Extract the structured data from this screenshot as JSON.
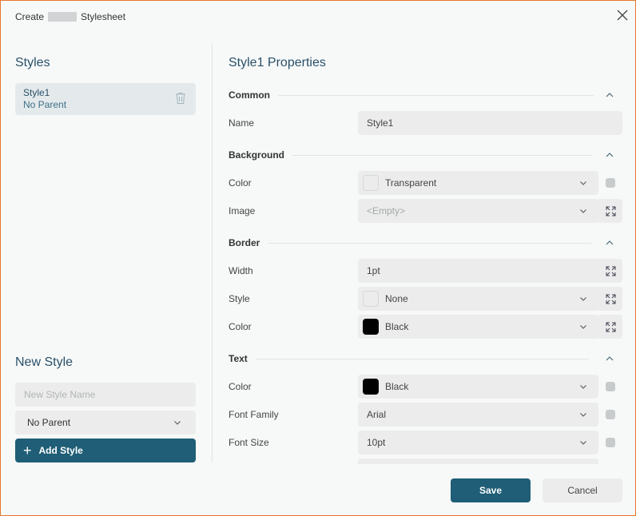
{
  "dialog": {
    "title_prefix": "Create",
    "title_suffix": "Stylesheet",
    "close_icon": "close-icon"
  },
  "left": {
    "styles_heading": "Styles",
    "styles": [
      {
        "name": "Style1",
        "parent": "No Parent",
        "delete_icon": "trash-icon"
      }
    ],
    "new_style_heading": "New Style",
    "new_style_name_placeholder": "New Style Name",
    "new_style_name_value": "",
    "parent_select_value": "No Parent",
    "add_style_label": "Add Style"
  },
  "right": {
    "heading": "Style1 Properties",
    "groups": {
      "common": {
        "title": "Common",
        "name_label": "Name",
        "name_value": "Style1"
      },
      "background": {
        "title": "Background",
        "color_label": "Color",
        "color_value": "Transparent",
        "image_label": "Image",
        "image_value": "<Empty>"
      },
      "border": {
        "title": "Border",
        "width_label": "Width",
        "width_value": "1pt",
        "style_label": "Style",
        "style_value": "None",
        "color_label": "Color",
        "color_value": "Black"
      },
      "text": {
        "title": "Text",
        "color_label": "Color",
        "color_value": "Black",
        "font_family_label": "Font Family",
        "font_family_value": "Arial",
        "font_size_label": "Font Size",
        "font_size_value": "10pt"
      }
    }
  },
  "footer": {
    "save_label": "Save",
    "cancel_label": "Cancel"
  },
  "colors": {
    "accent": "#1f5e76",
    "heading": "#2a5068",
    "window_border": "#e8752c",
    "field_bg": "#ebeceb",
    "selected_item_bg": "#e4eaec"
  }
}
